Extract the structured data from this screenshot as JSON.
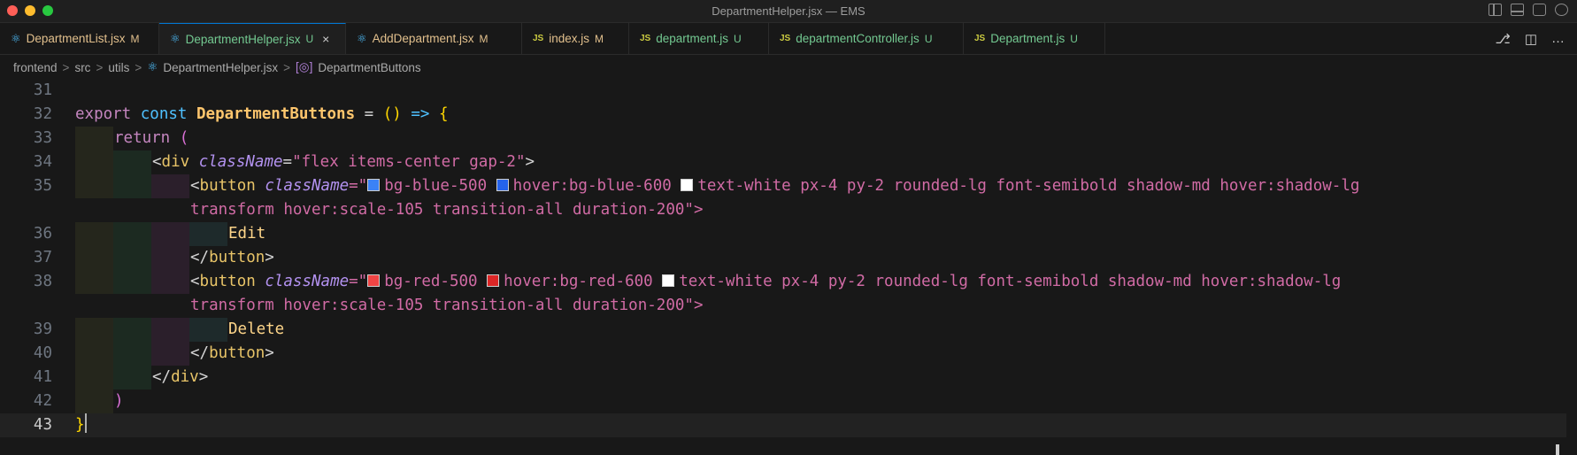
{
  "window": {
    "title": "DepartmentHelper.jsx — EMS"
  },
  "tabs": [
    {
      "name": "DepartmentList.jsx",
      "status": "M",
      "icon": "react-icon"
    },
    {
      "name": "DepartmentHelper.jsx",
      "status": "U",
      "icon": "react-icon",
      "active": true,
      "close": "×"
    },
    {
      "name": "AddDepartment.jsx",
      "status": "M",
      "icon": "react-icon"
    },
    {
      "name": "index.js",
      "status": "M",
      "icon": "js-icon"
    },
    {
      "name": "department.js",
      "status": "U",
      "icon": "js-icon"
    },
    {
      "name": "departmentController.js",
      "status": "U",
      "icon": "js-icon"
    },
    {
      "name": "Department.js",
      "status": "U",
      "icon": "js-icon"
    }
  ],
  "icon_labels": {
    "react": "⚛",
    "js": "JS"
  },
  "tab_actions": [
    "⎇",
    "◫",
    "…"
  ],
  "breadcrumb": {
    "items": [
      "frontend",
      "src",
      "utils",
      "DepartmentHelper.jsx",
      "DepartmentButtons"
    ],
    "separator": ">"
  },
  "editor": {
    "line_numbers": [
      "31",
      "32",
      "33",
      "34",
      "35",
      "36",
      "37",
      "38",
      "39",
      "40",
      "41",
      "42",
      "43"
    ],
    "current_line": "43",
    "code": {
      "l32_export": "export",
      "l32_const": "const",
      "l32_name": "DepartmentButtons",
      "l32_eq": "=",
      "l32_parens": "()",
      "l32_arrow": "=>",
      "l32_brace": "{",
      "l33_return": "return",
      "l33_paren": "(",
      "l34_open": "<",
      "l34_tag": "div",
      "l34_attr": "className",
      "l34_eq": "=",
      "l34_val": "\"flex items-center gap-2\"",
      "l34_close": ">",
      "l35_open": "<",
      "l35_tag": "button",
      "l35_attr": "className",
      "l35_eq": "=\"",
      "l35_c1": "bg-blue-500",
      "l35_c2": "hover:bg-blue-600",
      "l35_c3": "text-white px-4 py-2 rounded-lg font-semibold shadow-md hover:shadow-lg",
      "l35b_cont": "transform hover:scale-105 transition-all duration-200",
      "l35b_end": "\">",
      "l36_text": "Edit",
      "l37_close": "</",
      "l37_tag": "button",
      "l37_end": ">",
      "l38_open": "<",
      "l38_tag": "button",
      "l38_attr": "className",
      "l38_eq": "=\"",
      "l38_c1": "bg-red-500",
      "l38_c2": "hover:bg-red-600",
      "l38_c3": "text-white px-4 py-2 rounded-lg font-semibold shadow-md hover:shadow-lg",
      "l38b_cont": "transform hover:scale-105 transition-all duration-200",
      "l38b_end": "\">",
      "l39_text": "Delete",
      "l40_close": "</",
      "l40_tag": "button",
      "l40_end": ">",
      "l41_close": "</",
      "l41_tag": "div",
      "l41_end": ">",
      "l42_paren": ")",
      "l43_brace": "}"
    },
    "swatch_colors": {
      "blue500": "#3b82f6",
      "blue600": "#2563eb",
      "red500": "#ef4444",
      "red600": "#dc2626",
      "white": "#ffffff"
    }
  }
}
